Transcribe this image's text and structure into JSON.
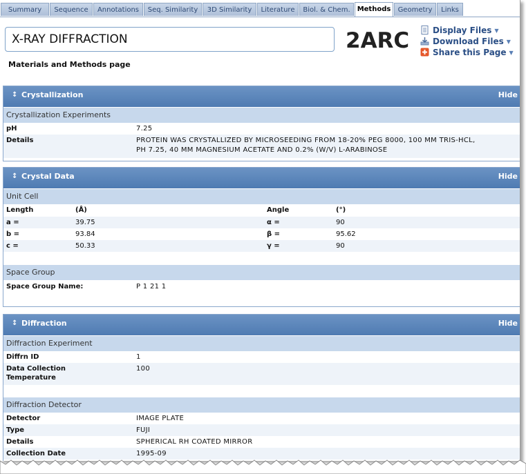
{
  "tabs": [
    {
      "label": "Summary"
    },
    {
      "label": "Sequence"
    },
    {
      "label": "Annotations"
    },
    {
      "label": "Seq. Similarity"
    },
    {
      "label": "3D Similarity"
    },
    {
      "label": "Literature"
    },
    {
      "label": "Biol. & Chem."
    },
    {
      "label": "Methods"
    },
    {
      "label": "Geometry"
    },
    {
      "label": "Links"
    }
  ],
  "header": {
    "title": "X-RAY DIFFRACTION",
    "pdb_id": "2ARC",
    "display_files": "Display Files",
    "download_files": "Download Files",
    "share_page": "Share this Page",
    "subtitle": "Materials and Methods page"
  },
  "hide_label": "Hide",
  "crystallization": {
    "title": "Crystallization",
    "section": "Crystallization Experiments",
    "ph_label": "pH",
    "ph_value": "7.25",
    "details_label": "Details",
    "details_line1": "PROTEIN WAS CRYSTALLIZED BY MICROSEEDING FROM 18-20% PEG 8000, 100 MM TRIS-HCL,",
    "details_line2": "PH 7.25, 40 MM MAGNESIUM ACETATE AND 0.2% (W/V) L-ARABINOSE"
  },
  "crystal_data": {
    "title": "Crystal Data",
    "unit_cell": "Unit Cell",
    "length_header": "Length",
    "length_unit": "(Å)",
    "angle_header": "Angle",
    "angle_unit": "(°)",
    "rows": [
      {
        "l": "a =",
        "lv": "39.75",
        "a": "α =",
        "av": "90"
      },
      {
        "l": "b =",
        "lv": "93.84",
        "a": "β =",
        "av": "95.62"
      },
      {
        "l": "c =",
        "lv": "50.33",
        "a": "γ =",
        "av": "90"
      }
    ],
    "space_group": "Space Group",
    "space_group_label": "Space Group Name:",
    "space_group_value": "P 1 21 1"
  },
  "diffraction": {
    "title": "Diffraction",
    "experiment": "Diffraction Experiment",
    "diffrn_id_label": "Diffrn ID",
    "diffrn_id_value": "1",
    "temp_label_1": "Data Collection",
    "temp_label_2": "Temperature",
    "temp_value": "100",
    "detector_section": "Diffraction Detector",
    "detector_label": "Detector",
    "detector_value": "IMAGE PLATE",
    "type_label": "Type",
    "type_value": "FUJI",
    "details_label": "Details",
    "details_value": "SPHERICAL RH COATED MIRROR",
    "date_label": "Collection Date",
    "date_value": "1995-09"
  }
}
